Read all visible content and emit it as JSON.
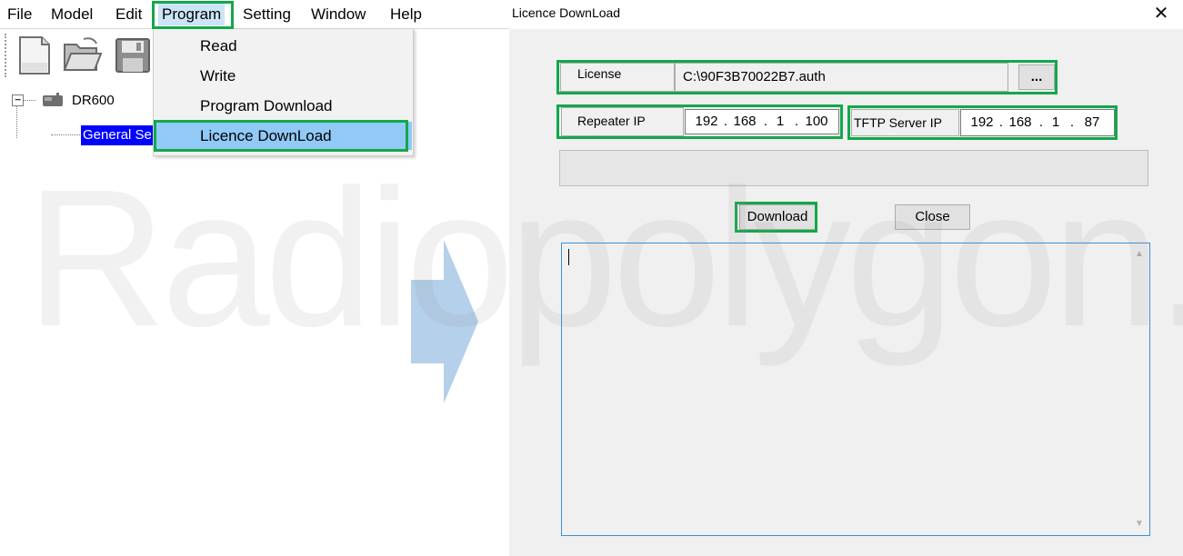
{
  "menubar": {
    "items": [
      "File",
      "Model",
      "Edit",
      "Program",
      "Setting",
      "Window",
      "Help"
    ]
  },
  "program_menu": {
    "items": [
      "Read",
      "Write",
      "Program Download",
      "Licence DownLoad"
    ]
  },
  "tree": {
    "root": "DR600",
    "child": "General Se"
  },
  "toolbar": {
    "icons": [
      "new-file-icon",
      "open-folder-icon",
      "save-icon"
    ]
  },
  "watermark": "Radiopolygon.ru",
  "dialog": {
    "title": "Licence DownLoad",
    "close_glyph": "✕",
    "license_label": "License",
    "license_value": "C:\\90F3B70022B7.auth",
    "browse_label": "...",
    "repeater_ip_label": "Repeater IP",
    "repeater_ip": [
      "192",
      ".",
      "168",
      ".",
      "1",
      ".",
      "100"
    ],
    "tftp_label": "TFTP Server IP",
    "tftp_ip": [
      "192",
      ".",
      "168",
      ".",
      "1",
      ".",
      "87"
    ],
    "download_label": "Download",
    "close_label": "Close",
    "log_text": ""
  },
  "colors": {
    "highlight": "#13a84a",
    "menu_selected": "#91c9f7",
    "tree_selected": "#0000ff",
    "arrow": "#a7c8e8"
  }
}
